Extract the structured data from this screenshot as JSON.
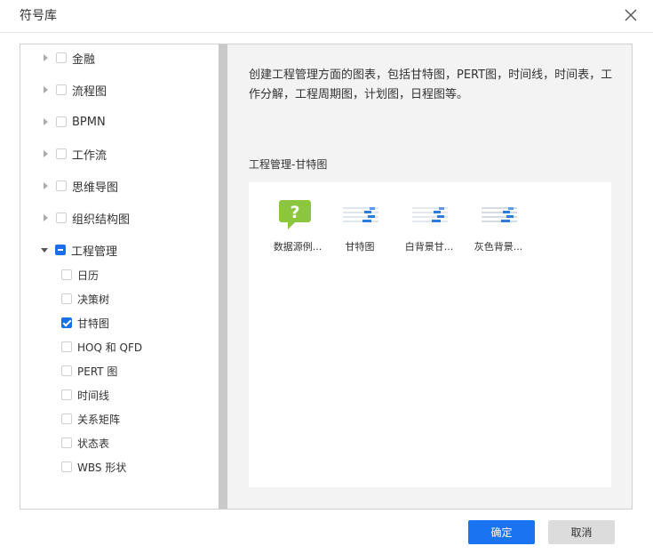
{
  "dialog": {
    "title": "符号库",
    "close_icon": "close-icon"
  },
  "tree": {
    "categories": [
      {
        "label": "金融",
        "expanded": false,
        "state": "unchecked"
      },
      {
        "label": "流程图",
        "expanded": false,
        "state": "unchecked"
      },
      {
        "label": "BPMN",
        "expanded": false,
        "state": "unchecked"
      },
      {
        "label": "工作流",
        "expanded": false,
        "state": "unchecked"
      },
      {
        "label": "思维导图",
        "expanded": false,
        "state": "unchecked"
      },
      {
        "label": "组织结构图",
        "expanded": false,
        "state": "unchecked"
      },
      {
        "label": "工程管理",
        "expanded": true,
        "state": "partial"
      }
    ],
    "children": [
      {
        "label": "日历",
        "checked": false
      },
      {
        "label": "决策树",
        "checked": false
      },
      {
        "label": "甘特图",
        "checked": true
      },
      {
        "label": "HOQ 和 QFD",
        "checked": false
      },
      {
        "label": "PERT 图",
        "checked": false
      },
      {
        "label": "时间线",
        "checked": false
      },
      {
        "label": "关系矩阵",
        "checked": false
      },
      {
        "label": "状态表",
        "checked": false
      },
      {
        "label": "WBS 形状",
        "checked": false
      }
    ]
  },
  "main": {
    "description": "创建工程管理方面的图表，包括甘特图，PERT图，时间线，时间表，工作分解，工程周期图，计划图，日程图等。",
    "section_title": "工程管理-甘特图",
    "shapes": [
      {
        "caption": "数据源例...",
        "icon": "help-question-icon"
      },
      {
        "caption": "甘特图",
        "icon": "gantt-chart-icon"
      },
      {
        "caption": "白背景甘...",
        "icon": "gantt-white-icon"
      },
      {
        "caption": "灰色背景...",
        "icon": "gantt-gray-icon"
      }
    ]
  },
  "footer": {
    "ok_label": "确定",
    "cancel_label": "取消"
  },
  "colors": {
    "accent": "#1a73f0",
    "check": "#1a6fe8",
    "help_icon": "#8cc63f"
  }
}
